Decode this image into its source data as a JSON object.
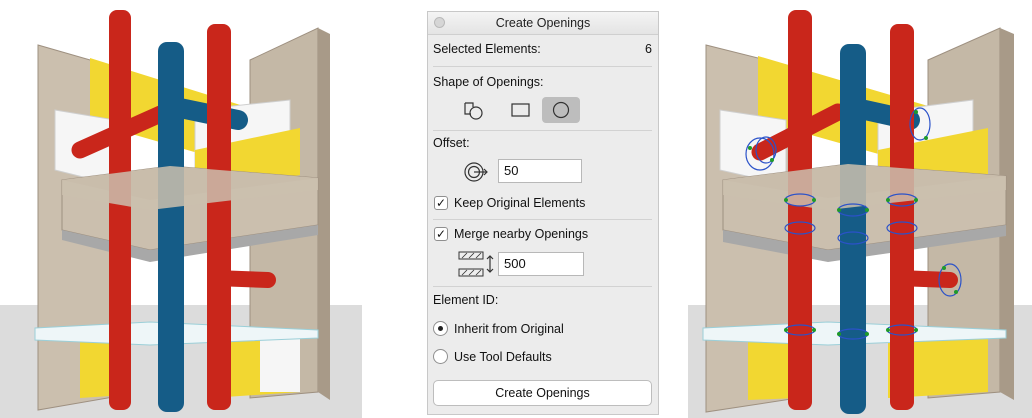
{
  "dialog": {
    "title": "Create Openings",
    "selected_label": "Selected Elements:",
    "selected_count": "6",
    "shape_label": "Shape of Openings:",
    "shapes": [
      {
        "name": "element-shape",
        "icon": "element-shape-icon"
      },
      {
        "name": "rectangular",
        "icon": "rectangle-icon"
      },
      {
        "name": "circular",
        "icon": "circle-icon",
        "selected": true
      }
    ],
    "offset_label": "Offset:",
    "offset_value": "50",
    "keep_original_label": "Keep Original Elements",
    "keep_original_checked": true,
    "merge_label": "Merge nearby Openings",
    "merge_checked": true,
    "merge_distance": "500",
    "element_id_label": "Element ID:",
    "radio_options": [
      {
        "label": "Inherit from Original",
        "selected": true
      },
      {
        "label": "Use Tool Defaults",
        "selected": false
      }
    ],
    "create_button": "Create Openings"
  },
  "colors": {
    "red_pipe": "#c9261b",
    "blue_pipe": "#155c87",
    "yellow_panel": "#f2d731",
    "concrete": "#cbbfae",
    "slab": "#b8b8b8",
    "opening_outline": "#2b52c9",
    "opening_marker": "#1f9a2a"
  }
}
